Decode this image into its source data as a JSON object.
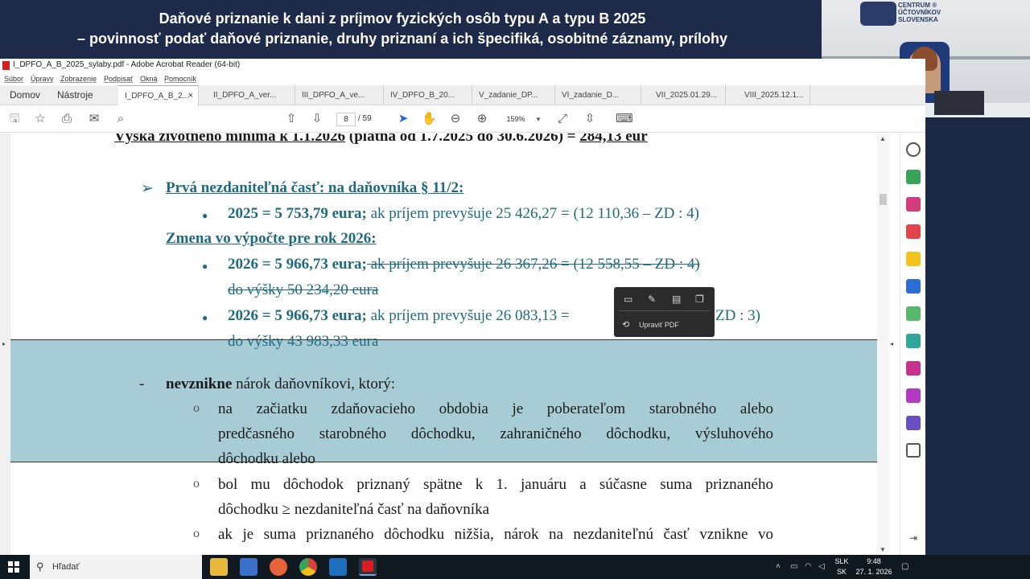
{
  "banner": {
    "line1": "Daňové priznanie k dani z príjmov fyzických osôb typu A a typu B 2025",
    "line2": "– povinnosť podať daňové priznanie, druhy priznaní a ich špecifiká, osobitné záznamy, prílohy"
  },
  "webcam": {
    "logo_text": "CENTRUM ® ÚČTOVNÍKOV SLOVENSKA"
  },
  "window": {
    "title": "I_DPFO_A_B_2025_sylaby.pdf - Adobe Acrobat Reader (64-bit)"
  },
  "menu": [
    "Súbor",
    "Úpravy",
    "Zobrazenie",
    "Podpísať",
    "Okná",
    "Pomocník"
  ],
  "tabs": {
    "home": "Domov",
    "tools": "Nástroje",
    "docs": [
      "I_DPFO_A_B_2...",
      "II_DPFO_A_ver...",
      "III_DPFO_A_ve...",
      "IV_DPFO_B_20...",
      "V_zadanie_DP...",
      "VI_zadanie_D...",
      "VII_2025.01.29...",
      "VIII_2025.12.1..."
    ],
    "close_glyph": "×"
  },
  "toolbar": {
    "page_current": "8",
    "page_total": "/ 59",
    "zoom": "159%"
  },
  "document": {
    "heading_partial": "Výška životného minima k 1.1.2026",
    "heading_mid": " (platná od 1.7.2025 do 30.6.2026) = ",
    "heading_value": "284,13 eur",
    "arrow": "➢",
    "first_part_title": "Prvá nezdaniteľná časť: na daňovníka § 11/2:",
    "line2025_bold": "2025 = 5 753,79 eura;",
    "line2025_rest": " ak príjem prevyšuje 25 426,27 = (12 110,36 – ZD : 4)",
    "change_title": "Zmena vo výpočte pre rok 2026:",
    "line2026a_bold": "2026 = 5 966,73 eura;",
    "line2026a_strike": " ak príjem prevyšuje 26 367,26 = (12 558,55 – ZD : 4)",
    "line2026a_strike2": "do výšky 50 234,20 eura",
    "line2026b_bold": "2026 = 5 966,73 eura;",
    "line2026b_rest": " ak príjem prevyšuje 26 083,13 =",
    "line2026b_tail": "ZD : 3)",
    "line2026b_2": "do výšky 43 983,33 eura",
    "dash": "-",
    "nevznikne_bold": "nevznikne",
    "nevznikne_rest": " nárok daňovníkovi, ktorý:",
    "circle": "o",
    "item1_l1": "na začiatku zdaňovacieho obdobia je poberateľom starobného alebo",
    "item1_l2": "predčasného starobného dôchodku, zahraničného dôchodku, výsluhového",
    "item1_l3": "dôchodku alebo",
    "item2_l1": "bol mu dôchodok priznaný spätne k 1. januáru a súčasne suma priznaného",
    "item2_l2": "dôchodku ≥ nezdaniteľná časť na daňovníka",
    "item3_l1": "ak je suma priznaného dôchodku nižšia, nárok na nezdaniteľnú časť vznikne vo"
  },
  "popup": {
    "edit_label": "Upraviť PDF"
  },
  "taskbar": {
    "search_placeholder": "Hľadať",
    "lang_top": "SLK",
    "lang_bottom": "SK",
    "time": "9:48",
    "date": "27. 1. 2026"
  }
}
